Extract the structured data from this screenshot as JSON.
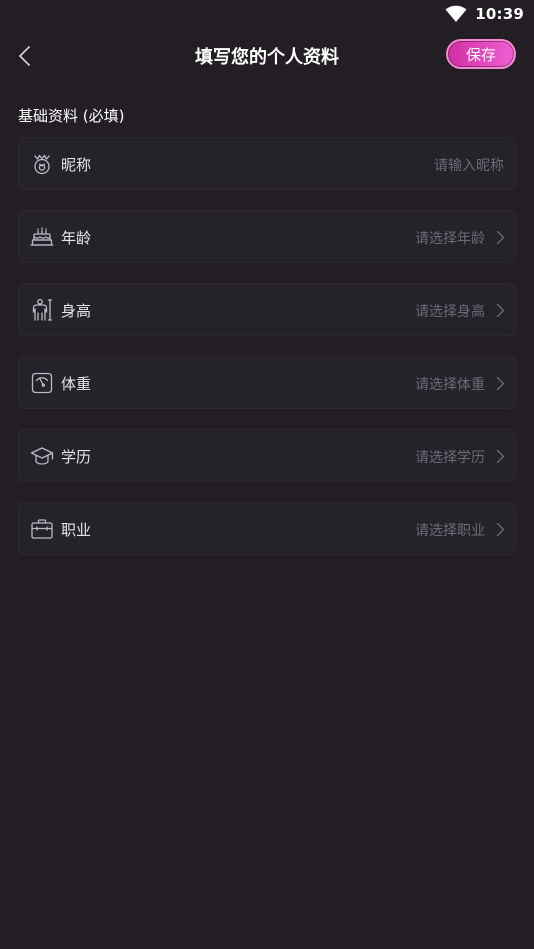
{
  "status_bar": {
    "time": "10:39",
    "wifi_icon": "wifi-icon"
  },
  "header": {
    "back_icon": "back-chevron-icon",
    "title": "填写您的个人资料",
    "save_label": "保存",
    "save_gradient": [
      "#d22fa4",
      "#ef5fd1"
    ]
  },
  "section": {
    "title": "基础资料 (必填)"
  },
  "fields": [
    {
      "label": "昵称",
      "placeholder": "请输入昵称",
      "icon": "nickname-icon",
      "chevron": false
    },
    {
      "label": "年龄",
      "placeholder": "请选择年龄",
      "icon": "cake-icon",
      "chevron": true
    },
    {
      "label": "身高",
      "placeholder": "请选择身高",
      "icon": "height-icon",
      "chevron": true
    },
    {
      "label": "体重",
      "placeholder": "请选择体重",
      "icon": "scale-icon",
      "chevron": true
    },
    {
      "label": "学历",
      "placeholder": "请选择学历",
      "icon": "graduation-cap-icon",
      "chevron": true
    },
    {
      "label": "职业",
      "placeholder": "请选择职业",
      "icon": "briefcase-icon",
      "chevron": true
    }
  ],
  "colors": {
    "background": "#221e24",
    "row_background": "#26222a",
    "placeholder_text": "#6e6a73",
    "accent": "#e040b8"
  }
}
